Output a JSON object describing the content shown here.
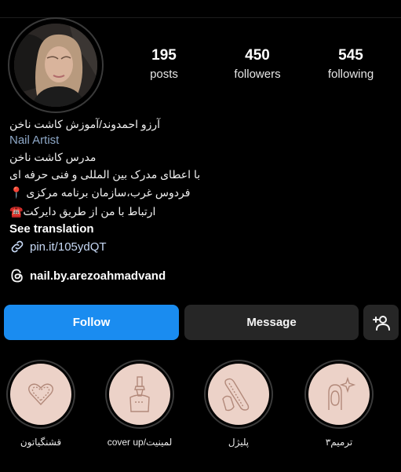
{
  "profile": {
    "posts_count": "195",
    "posts_label": "posts",
    "followers_count": "450",
    "followers_label": "followers",
    "following_count": "545",
    "following_label": "following"
  },
  "bio": {
    "name": "آرزو احمدوند/آموزش کاشت ناخن",
    "category": "Nail Artist",
    "line1": "مدرس کاشت ناخن",
    "line2": "با اعطای مدرک بین المللی و فنی حرفه ای",
    "line3": "فردوس غرب،سازمان برنامه مرکزی 📍",
    "line4": "ارتباط با من از طریق دایرکت☎️",
    "see_translation": "See translation",
    "link": "pin.it/105ydQT",
    "threads": "nail.by.arezoahmadvand"
  },
  "actions": {
    "follow": "Follow",
    "message": "Message"
  },
  "highlights": [
    {
      "label": "قشنگیاتون",
      "icon": "heart-icon"
    },
    {
      "label": "cover up/لمینیت",
      "icon": "brush-icon"
    },
    {
      "label": "پلیژل",
      "icon": "nail-file-icon"
    },
    {
      "label": "ترمیم۳",
      "icon": "nail-sparkle-icon"
    }
  ],
  "colors": {
    "follow_button": "#1a8cf0",
    "secondary_button": "#262626",
    "highlight_fill": "#ecd2c8",
    "highlight_stroke": "#b2897a"
  }
}
